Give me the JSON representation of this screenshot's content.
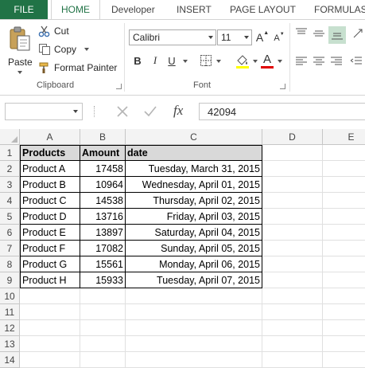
{
  "ribbon_tabs": {
    "file": "FILE",
    "home": "HOME",
    "developer": "Developer",
    "insert": "INSERT",
    "page_layout": "PAGE LAYOUT",
    "formulas": "FORMULAS"
  },
  "clipboard": {
    "paste": "Paste",
    "cut": "Cut",
    "copy": "Copy",
    "format_painter": "Format Painter",
    "group_label": "Clipboard"
  },
  "font": {
    "family": "Calibri",
    "size": "11",
    "bold": "B",
    "italic": "I",
    "underline": "U",
    "grow": "A",
    "shrink": "A",
    "font_color_letter": "A",
    "group_label": "Font"
  },
  "formula_bar": {
    "name_box": "",
    "fx": "fx",
    "value": "42094"
  },
  "columns": [
    "A",
    "B",
    "C",
    "D",
    "E"
  ],
  "rows": [
    "1",
    "2",
    "3",
    "4",
    "5",
    "6",
    "7",
    "8",
    "9",
    "10",
    "11",
    "12",
    "13",
    "14"
  ],
  "table": {
    "headers": [
      "Products",
      "Amount",
      "date"
    ],
    "rows": [
      [
        "Product A",
        "17458",
        "Tuesday, March 31, 2015"
      ],
      [
        "Product B",
        "10964",
        "Wednesday, April 01, 2015"
      ],
      [
        "Product C",
        "14538",
        "Thursday, April 02, 2015"
      ],
      [
        "Product D",
        "13716",
        "Friday, April 03, 2015"
      ],
      [
        "Product E",
        "13897",
        "Saturday, April 04, 2015"
      ],
      [
        "Product F",
        "17082",
        "Sunday, April 05, 2015"
      ],
      [
        "Product G",
        "15561",
        "Monday, April 06, 2015"
      ],
      [
        "Product H",
        "15933",
        "Tuesday, April 07, 2015"
      ]
    ]
  },
  "colors": {
    "accent": "#217346",
    "header_fill": "#d9d9d9",
    "font_color_bar": "#e00000"
  }
}
